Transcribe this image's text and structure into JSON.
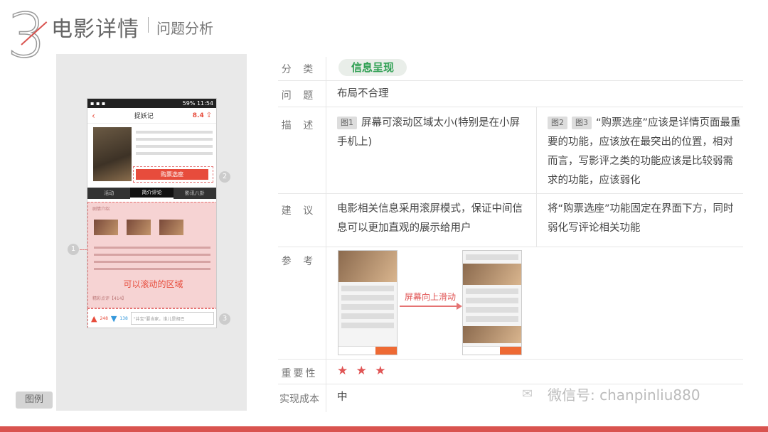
{
  "header": {
    "number": "3",
    "title": "电影详情",
    "subtitle": "问题分析"
  },
  "legend_label": "图例",
  "phone": {
    "status_time": "11:54",
    "status_battery": "59%",
    "movie_title": "捉妖记",
    "score": "8.4",
    "buy_label": "购票选座",
    "tabs": [
      "活动",
      "简介评论",
      "影讯八卦"
    ],
    "intro_header": "剧情介绍",
    "scroll_label": "可以滚动的区域",
    "comment_count": "精彩点评【414】",
    "comment_placeholder": "\"井宝\"要当家，谁儿是胡巴",
    "up_count": "248",
    "down_count": "138"
  },
  "markers": [
    "1",
    "2",
    "3"
  ],
  "table": {
    "category": {
      "label": "分  类",
      "value": "信息呈现"
    },
    "problem": {
      "label": "问  题",
      "value": "布局不合理"
    },
    "description": {
      "label": "描  述",
      "left_tags": [
        "图1"
      ],
      "left_text": "屏幕可滚动区域太小(特别是在小屏手机上)",
      "right_tags": [
        "图2",
        "图3"
      ],
      "right_text": "“购票选座”应该是详情页面最重要的功能，应该放在最突出的位置，相对而言，写影评之类的功能应该是比较弱需求的功能，应该弱化"
    },
    "suggestion": {
      "label": "建  议",
      "left_text": "电影相关信息采用滚屏模式，保证中间信息可以更加直观的展示给用户",
      "right_text": "将“购票选座”功能固定在界面下方，同时弱化写评论相关功能"
    },
    "reference": {
      "label": "参  考",
      "arrow_label": "屏幕向上滑动"
    },
    "importance": {
      "label": "重要性",
      "stars": "★ ★ ★",
      "rating": 3,
      "max": 3
    },
    "cost": {
      "label": "实现成本",
      "value": "中"
    }
  },
  "watermark": "微信号: chanpinliu880",
  "colors": {
    "accent": "#d9534f",
    "green": "#2e9f52",
    "star": "#e05555"
  }
}
